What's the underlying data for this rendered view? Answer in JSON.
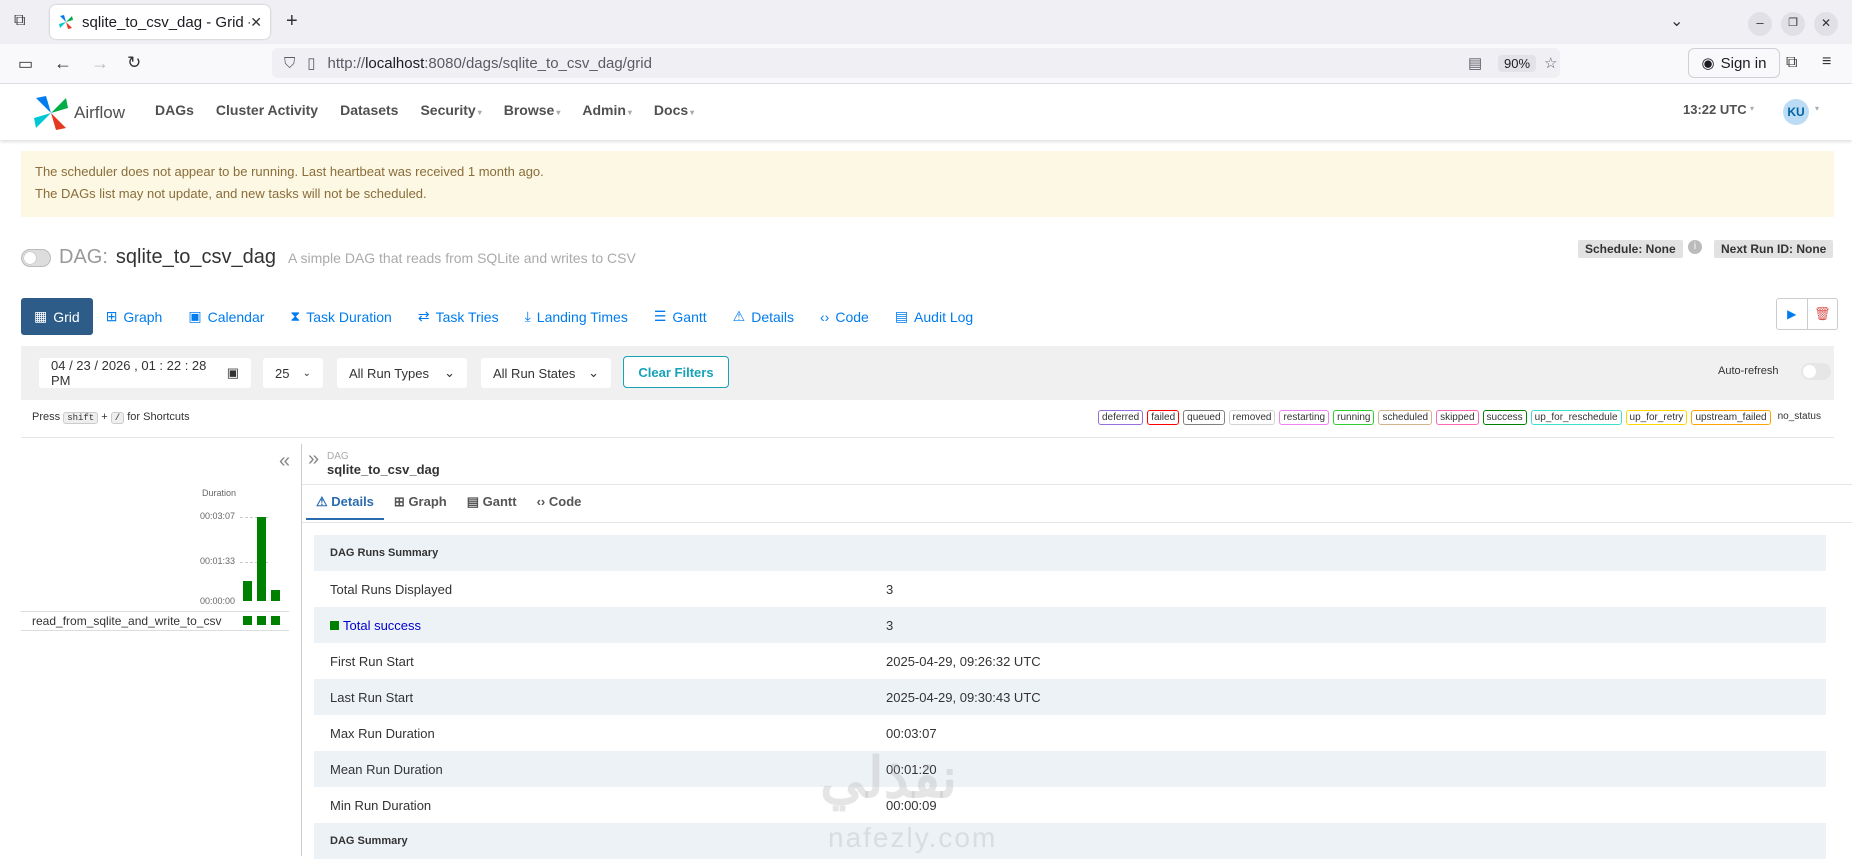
{
  "browser": {
    "tab_title": "sqlite_to_csv_dag - Grid -",
    "url_prefix": "http://",
    "url_host": "localhost",
    "url_rest": ":8080/dags/sqlite_to_csv_dag/grid",
    "zoom": "90%",
    "sign_in": "Sign in"
  },
  "app": {
    "logo_text": "Airflow",
    "menu": [
      "DAGs",
      "Cluster Activity",
      "Datasets",
      "Security",
      "Browse",
      "Admin",
      "Docs"
    ],
    "time": "13:22 UTC",
    "user_initials": "KU"
  },
  "alert": {
    "line1": "The scheduler does not appear to be running. Last heartbeat was received 1 month ago.",
    "line2": "The DAGs list may not update, and new tasks will not be scheduled."
  },
  "dag": {
    "label": "DAG:",
    "name": "sqlite_to_csv_dag",
    "description": "A simple DAG that reads from SQLite and writes to CSV",
    "schedule": "Schedule: None",
    "next_run": "Next Run ID: None"
  },
  "view_tabs": [
    "Grid",
    "Graph",
    "Calendar",
    "Task Duration",
    "Task Tries",
    "Landing Times",
    "Gantt",
    "Details",
    "Code",
    "Audit Log"
  ],
  "filters": {
    "datetime": "04 / 23 / 2026 ,  01 : 22 : 28   PM",
    "limit": "25",
    "run_types": "All Run Types",
    "run_states": "All Run States",
    "clear": "Clear Filters",
    "auto_refresh": "Auto-refresh"
  },
  "shortcuts": {
    "press": "Press",
    "shift": "shift",
    "plus": "+",
    "slash": "/",
    "suffix": "for Shortcuts"
  },
  "legend": [
    {
      "label": "deferred",
      "color": "#9370db"
    },
    {
      "label": "failed",
      "color": "#ff0000"
    },
    {
      "label": "queued",
      "color": "#808080"
    },
    {
      "label": "removed",
      "color": "#d3d3d3"
    },
    {
      "label": "restarting",
      "color": "#ee82ee"
    },
    {
      "label": "running",
      "color": "#32cd32"
    },
    {
      "label": "scheduled",
      "color": "#d2b48c"
    },
    {
      "label": "skipped",
      "color": "#ff69b4"
    },
    {
      "label": "success",
      "color": "#008000"
    },
    {
      "label": "up_for_reschedule",
      "color": "#40e0d0"
    },
    {
      "label": "up_for_retry",
      "color": "#ffd700"
    },
    {
      "label": "upstream_failed",
      "color": "#ffa500"
    },
    {
      "label": "no_status",
      "color": "#ffffff"
    }
  ],
  "grid": {
    "duration_label": "Duration",
    "ticks": [
      "00:03:07",
      "00:01:33",
      "00:00:00"
    ],
    "task_name": "read_from_sqlite_and_write_to_csv",
    "run_durations": [
      0.24,
      1.0,
      0.13
    ]
  },
  "detail": {
    "breadcrumb_label": "DAG",
    "breadcrumb_name": "sqlite_to_csv_dag",
    "tabs": [
      "Details",
      "Graph",
      "Gantt",
      "Code"
    ],
    "section1": "DAG Runs Summary",
    "rows": [
      {
        "k": "Total Runs Displayed",
        "v": "3"
      },
      {
        "k": "Total success",
        "v": "3"
      },
      {
        "k": "First Run Start",
        "v": "2025-04-29, 09:26:32 UTC"
      },
      {
        "k": "Last Run Start",
        "v": "2025-04-29, 09:30:43 UTC"
      },
      {
        "k": "Max Run Duration",
        "v": "00:03:07"
      },
      {
        "k": "Mean Run Duration",
        "v": "00:01:20"
      },
      {
        "k": "Min Run Duration",
        "v": "00:00:09"
      }
    ],
    "section2": "DAG Summary"
  },
  "watermark": {
    "arabic": "نفذلي",
    "latin": "nafezly.com"
  }
}
